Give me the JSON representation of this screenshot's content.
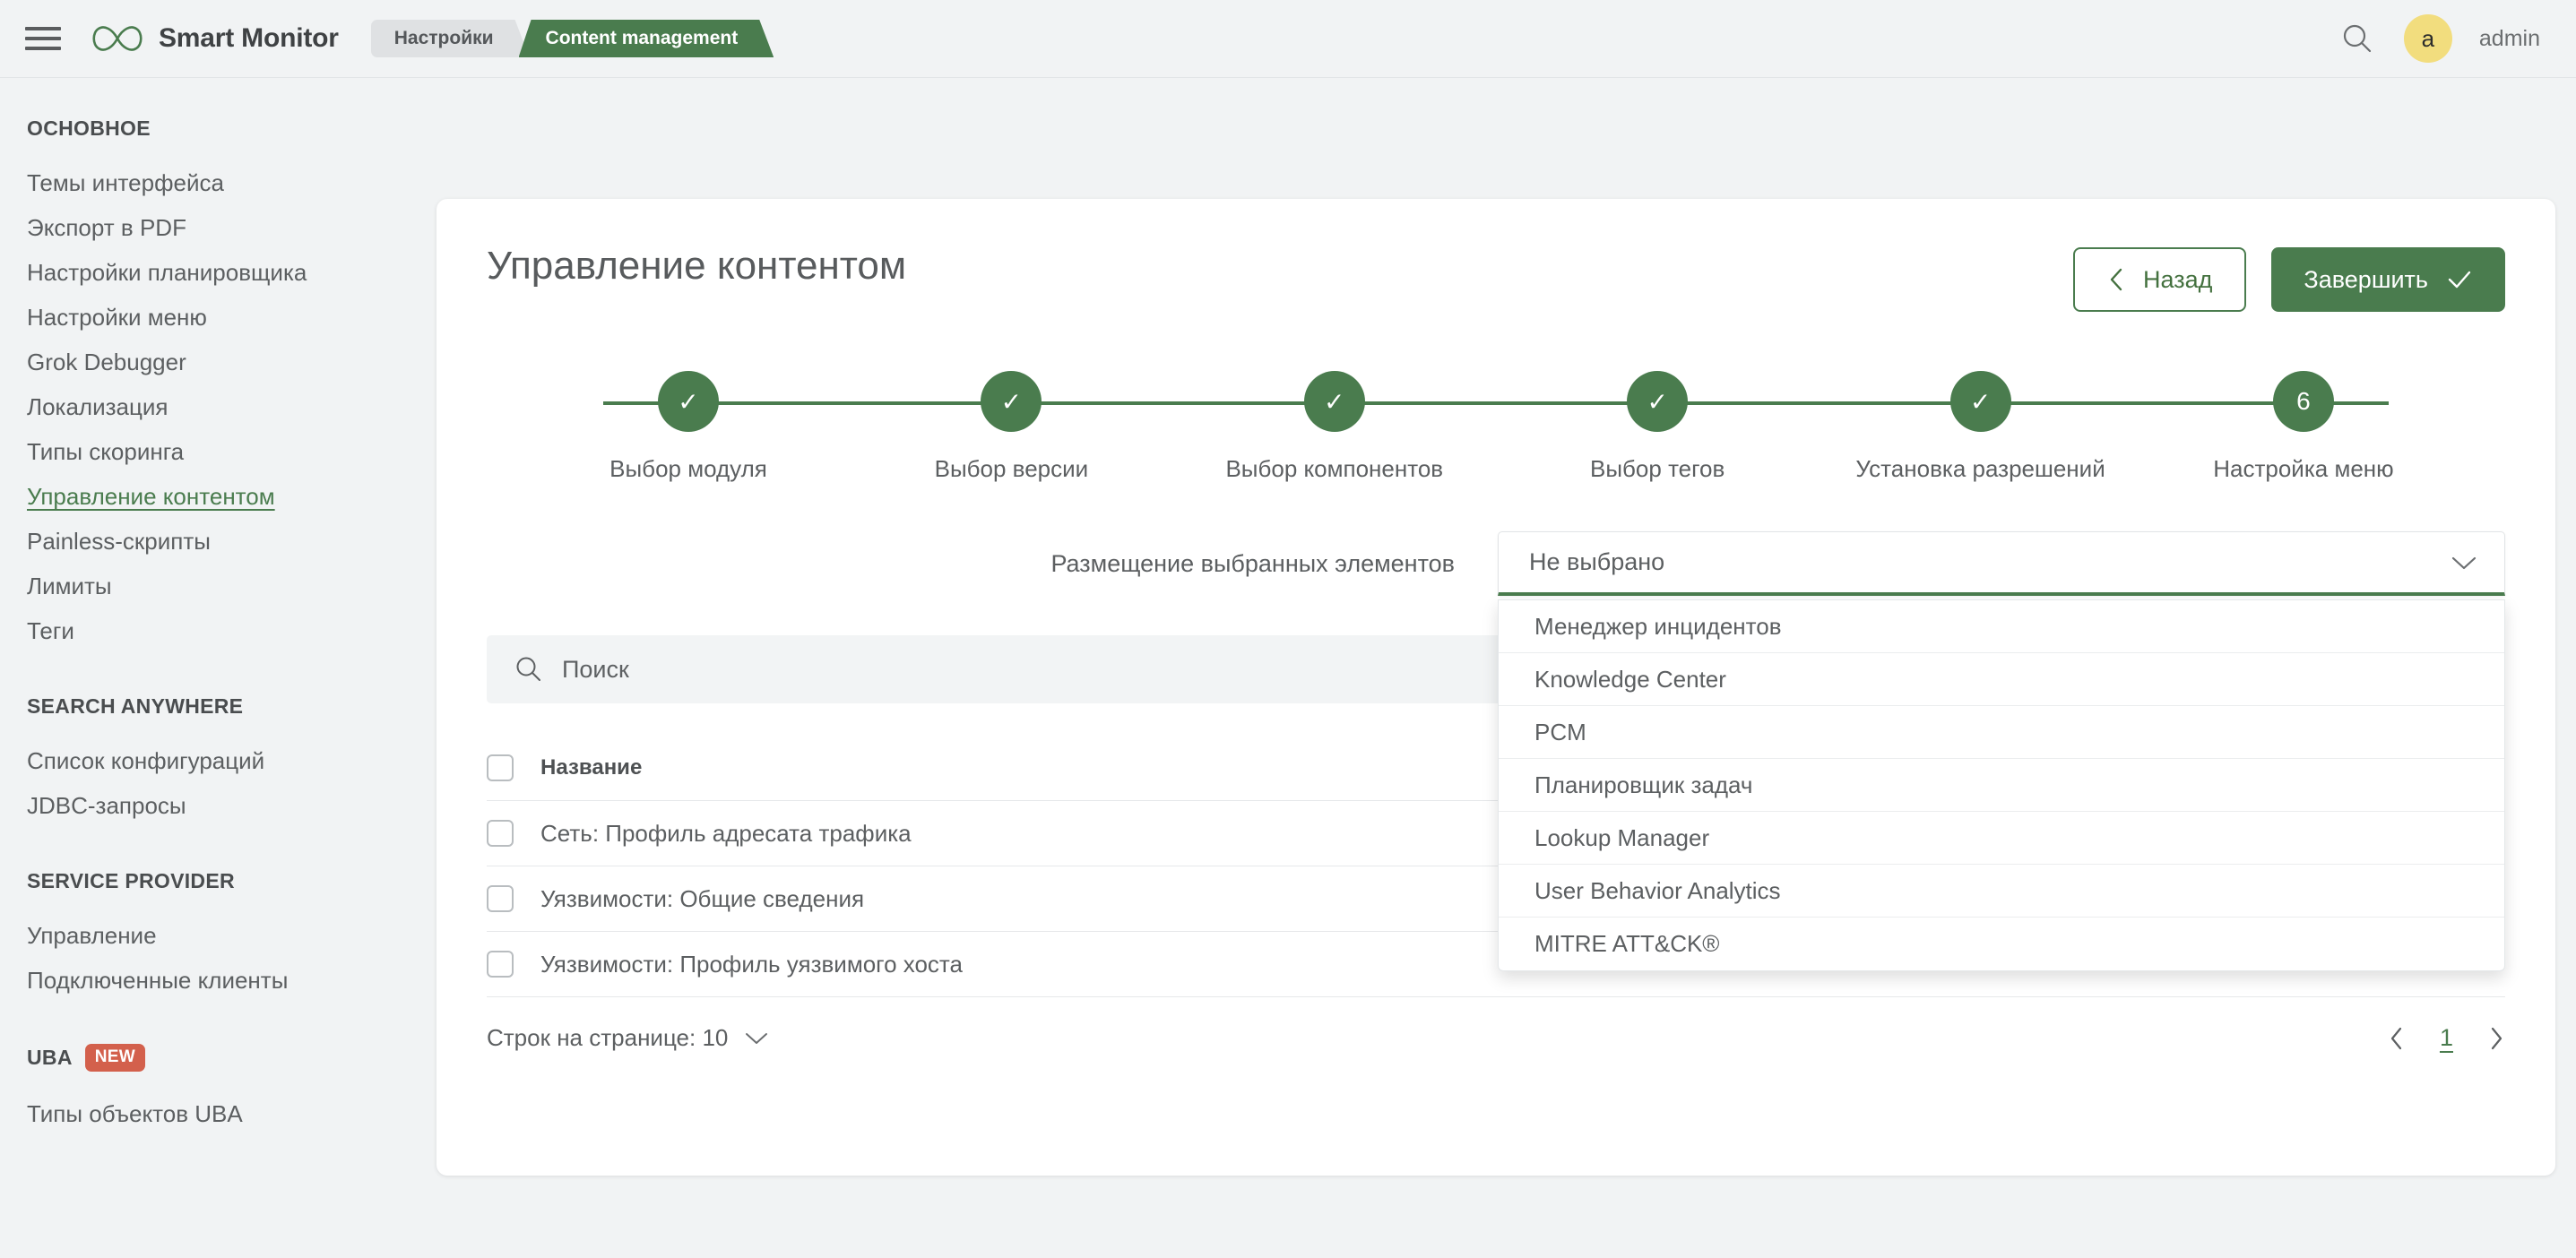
{
  "header": {
    "brand_name": "Smart Monitor",
    "tabs": [
      {
        "label": "Настройки",
        "active": false
      },
      {
        "label": "Content management",
        "active": true
      }
    ],
    "avatar_initial": "a",
    "username": "admin"
  },
  "sidebar": {
    "groups": [
      {
        "title": "ОСНОВНОЕ",
        "badge": null,
        "items": [
          {
            "label": "Темы интерфейса",
            "active": false
          },
          {
            "label": "Экспорт в PDF",
            "active": false
          },
          {
            "label": "Настройки планировщика",
            "active": false
          },
          {
            "label": "Настройки меню",
            "active": false
          },
          {
            "label": "Grok Debugger",
            "active": false
          },
          {
            "label": "Локализация",
            "active": false
          },
          {
            "label": "Типы скоринга",
            "active": false
          },
          {
            "label": "Управление контентом",
            "active": true
          },
          {
            "label": "Painless-скрипты",
            "active": false
          },
          {
            "label": "Лимиты",
            "active": false
          },
          {
            "label": "Теги",
            "active": false
          }
        ]
      },
      {
        "title": "SEARCH ANYWHERE",
        "badge": null,
        "items": [
          {
            "label": "Список конфигураций",
            "active": false
          },
          {
            "label": "JDBC-запросы",
            "active": false
          }
        ]
      },
      {
        "title": "SERVICE PROVIDER",
        "badge": null,
        "items": [
          {
            "label": "Управление",
            "active": false
          },
          {
            "label": "Подключенные клиенты",
            "active": false
          }
        ]
      },
      {
        "title": "UBA",
        "badge": "NEW",
        "items": [
          {
            "label": "Типы объектов UBA",
            "active": false
          }
        ]
      }
    ]
  },
  "main": {
    "title": "Управление контентом",
    "back_button": "Назад",
    "finish_button": "Завершить",
    "steps": [
      {
        "label": "Выбор модуля",
        "marker": "✓",
        "state": "done"
      },
      {
        "label": "Выбор версии",
        "marker": "✓",
        "state": "done"
      },
      {
        "label": "Выбор компонентов",
        "marker": "✓",
        "state": "done"
      },
      {
        "label": "Выбор тегов",
        "marker": "✓",
        "state": "done"
      },
      {
        "label": "Установка разрешений",
        "marker": "✓",
        "state": "done"
      },
      {
        "label": "Настройка меню",
        "marker": "6",
        "state": "current"
      }
    ],
    "placement": {
      "label": "Размещение выбранных элементов",
      "selected_value": "Не выбрано",
      "options": [
        "Менеджер инцидентов",
        "Knowledge Center",
        "PCM",
        "Планировщик задач",
        "Lookup Manager",
        "User Behavior Analytics",
        "MITRE ATT&CK®"
      ]
    },
    "search_placeholder": "Поиск",
    "table": {
      "columns": [
        "Название"
      ],
      "rows": [
        {
          "name": "Сеть: Профиль адресата трафика",
          "checked": false
        },
        {
          "name": "Уязвимости: Общие сведения",
          "checked": false
        },
        {
          "name": "Уязвимости: Профиль уязвимого хоста",
          "checked": false
        }
      ]
    },
    "footer": {
      "rows_per_page_label": "Строк на странице: 10",
      "current_page": "1"
    }
  },
  "colors": {
    "accent_green": "#4a7c4e",
    "badge_red": "#d3604c",
    "avatar_yellow": "#f2dd7e",
    "page_background": "#f1f3f4"
  }
}
